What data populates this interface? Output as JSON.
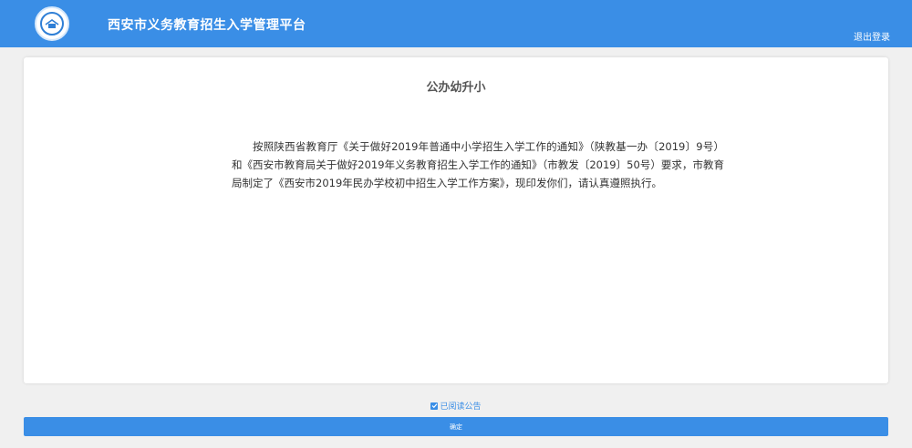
{
  "header": {
    "app_title": "西安市义务教育招生入学管理平台",
    "logout_label": "退出登录",
    "logo_icon": "school-emblem-icon"
  },
  "notice": {
    "title": "公办幼升小",
    "body": "按照陕西省教育厅《关于做好2019年普通中小学招生入学工作的通知》（陕教基一办〔2019〕9号）和《西安市教育局关于做好2019年义务教育招生入学工作的通知》（市教发〔2019〕50号）要求，市教育局制定了《西安市2019年民办学校初中招生入学工作方案》，现印发你们，请认真遵照执行。"
  },
  "acknowledge": {
    "label": "已阅读公告",
    "checked": true
  },
  "confirm_button": {
    "label": "确定"
  },
  "colors": {
    "primary": "#3a8ee6",
    "background": "#f0f0f0",
    "card": "#ffffff"
  }
}
